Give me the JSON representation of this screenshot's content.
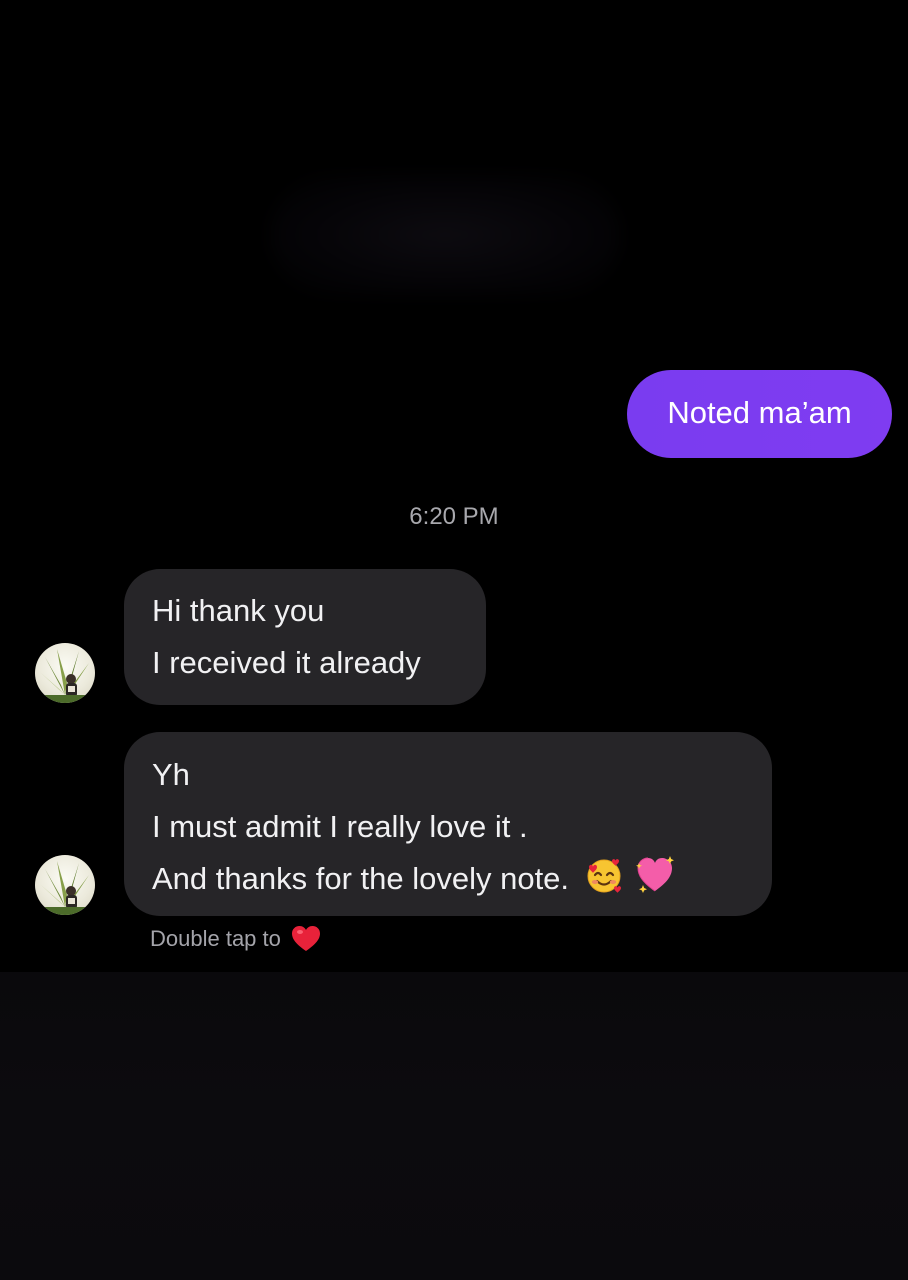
{
  "conversation": {
    "outgoing": [
      {
        "text": "Noted ma’am"
      }
    ],
    "timestamp": "6:20 PM",
    "incoming": [
      {
        "lines": [
          "Hi thank you",
          "I received it already"
        ]
      },
      {
        "lines": [
          "Yh",
          "I must admit I really love it .",
          "And thanks for the lovely note."
        ],
        "emojis": [
          "smiling-face-with-hearts",
          "sparkling-heart"
        ]
      }
    ],
    "reaction_hint": "Double tap to",
    "reaction_icon": "red-heart"
  },
  "colors": {
    "background": "#000000",
    "outgoing_bubble": "#7c3aed",
    "incoming_bubble": "#262528",
    "timestamp_text": "#a8a8ad"
  }
}
